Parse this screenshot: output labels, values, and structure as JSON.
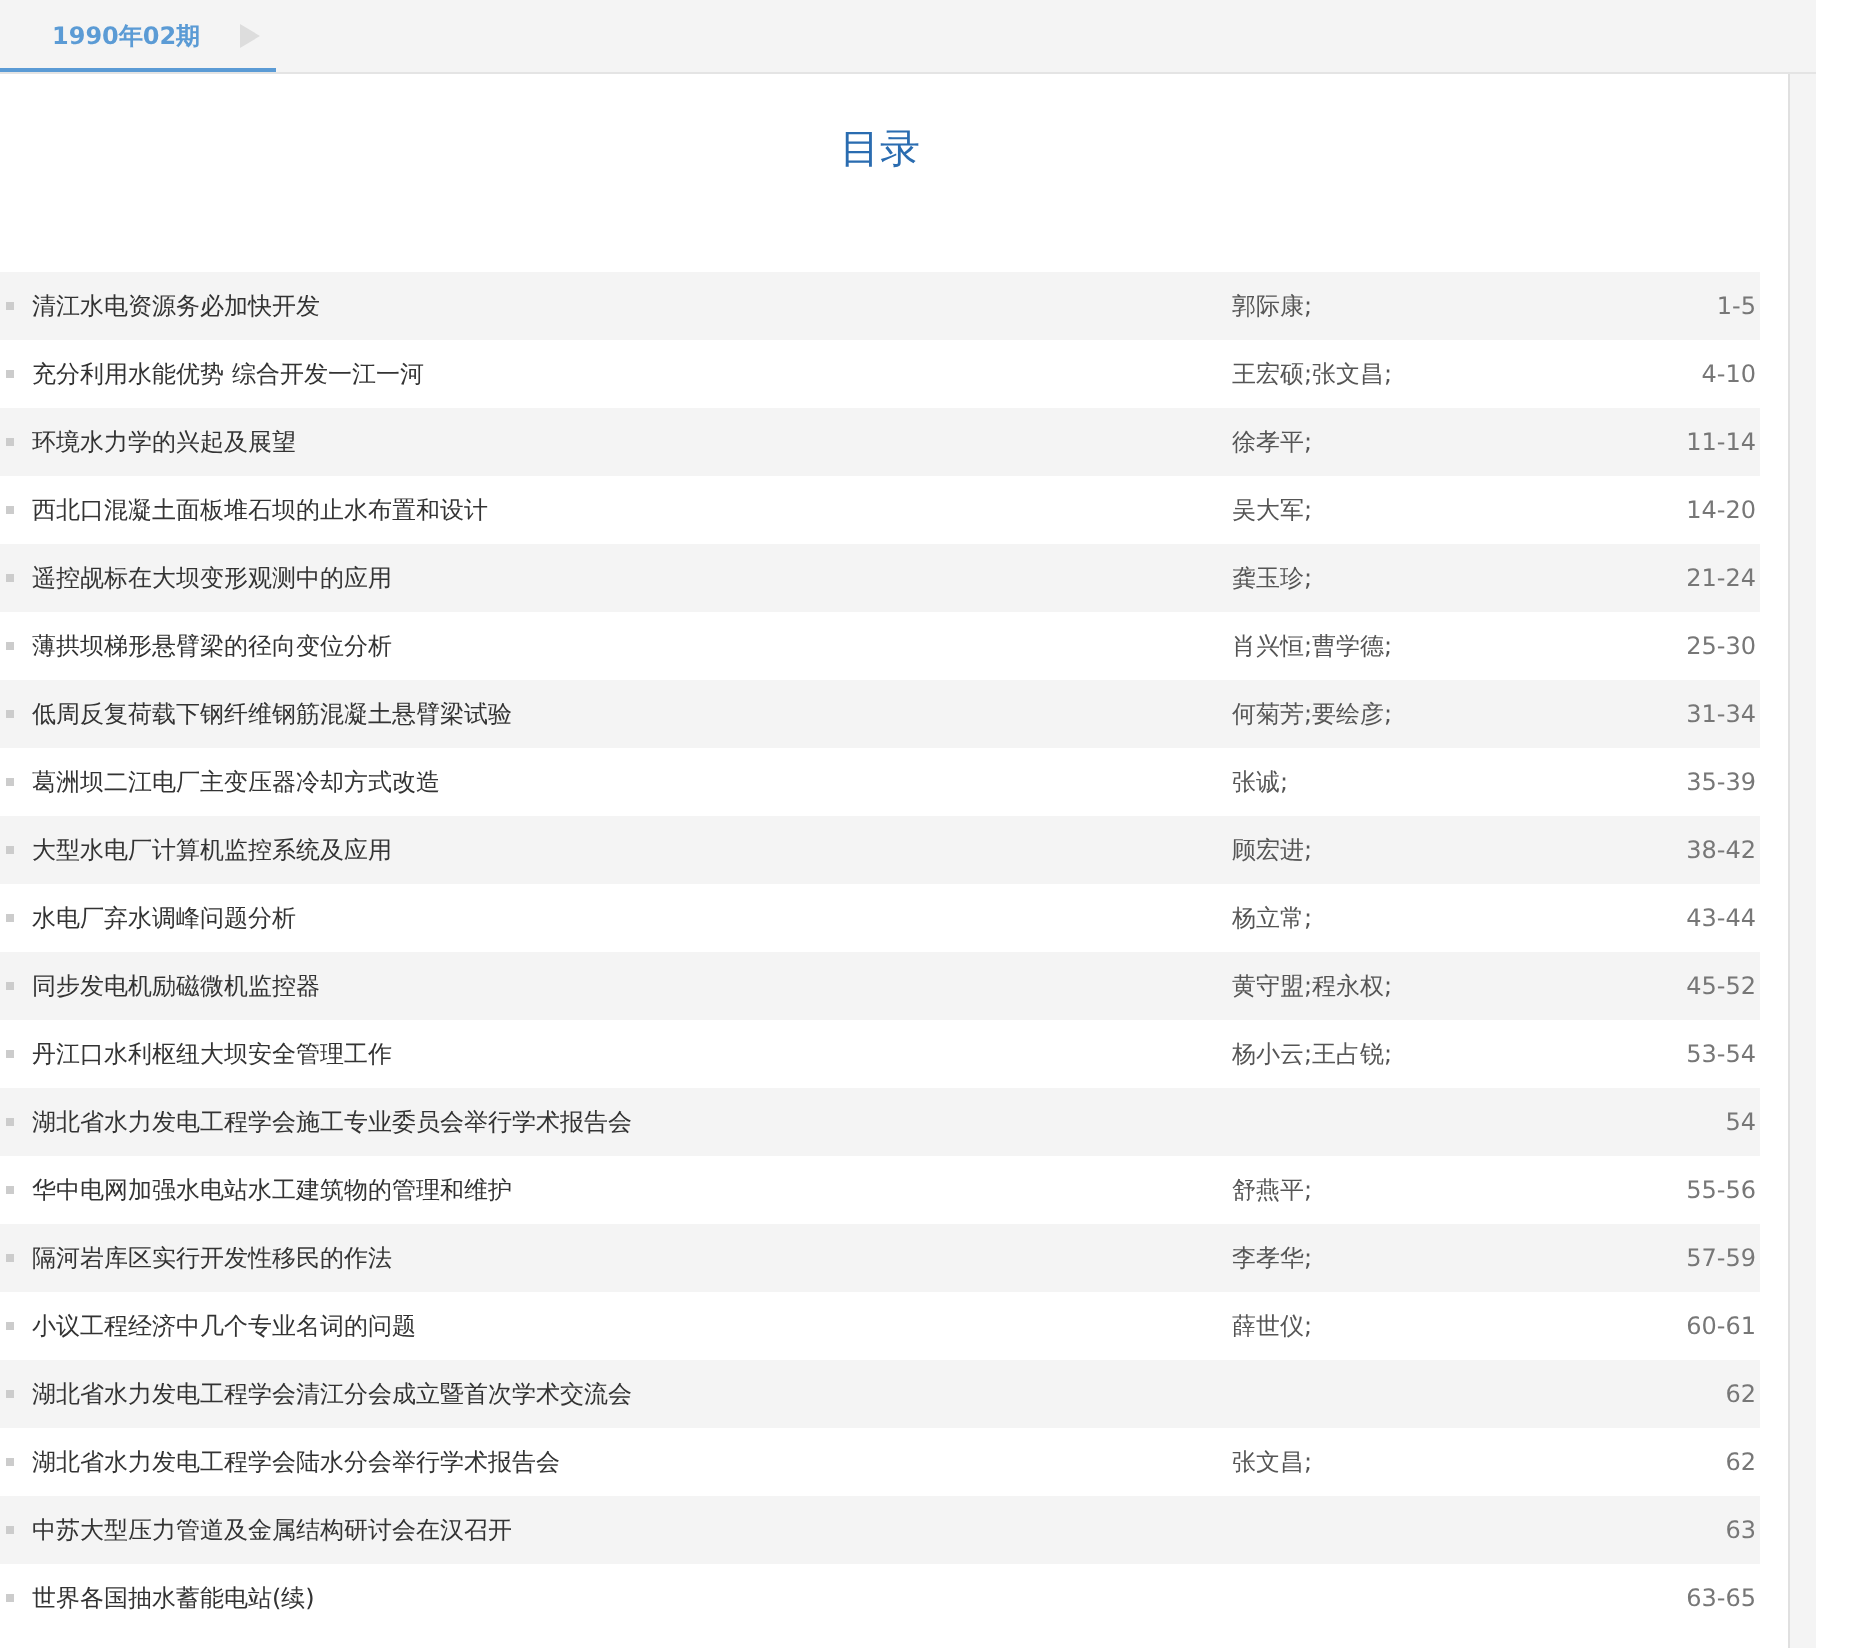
{
  "tabs": [
    {
      "label": "1990年02期",
      "selected": true
    }
  ],
  "title": "目录",
  "articles": [
    {
      "title": "清江水电资源务必加快开发",
      "authors": "郭际康;",
      "pages": "1-5"
    },
    {
      "title": "充分利用水能优势 综合开发一江一河",
      "authors": "王宏硕;张文昌;",
      "pages": "4-10"
    },
    {
      "title": "环境水力学的兴起及展望",
      "authors": "徐孝平;",
      "pages": "11-14"
    },
    {
      "title": "西北口混凝土面板堆石坝的止水布置和设计",
      "authors": "吴大军;",
      "pages": "14-20"
    },
    {
      "title": "遥控觇标在大坝变形观测中的应用",
      "authors": "龚玉珍;",
      "pages": "21-24"
    },
    {
      "title": "薄拱坝梯形悬臂梁的径向变位分析",
      "authors": "肖兴恒;曹学德;",
      "pages": "25-30"
    },
    {
      "title": "低周反复荷载下钢纤维钢筋混凝土悬臂梁试验",
      "authors": "何菊芳;要绘彦;",
      "pages": "31-34"
    },
    {
      "title": "葛洲坝二江电厂主变压器冷却方式改造",
      "authors": "张诚;",
      "pages": "35-39"
    },
    {
      "title": "大型水电厂计算机监控系统及应用",
      "authors": "顾宏进;",
      "pages": "38-42"
    },
    {
      "title": "水电厂弃水调峰问题分析",
      "authors": "杨立常;",
      "pages": "43-44"
    },
    {
      "title": "同步发电机励磁微机监控器",
      "authors": "黄守盟;程永权;",
      "pages": "45-52"
    },
    {
      "title": "丹江口水利枢纽大坝安全管理工作",
      "authors": "杨小云;王占锐;",
      "pages": "53-54"
    },
    {
      "title": "湖北省水力发电工程学会施工专业委员会举行学术报告会",
      "pages": "54"
    },
    {
      "title": "华中电网加强水电站水工建筑物的管理和维护",
      "authors": "舒燕平;",
      "pages": "55-56"
    },
    {
      "title": "隔河岩库区实行开发性移民的作法",
      "authors": "李孝华;",
      "pages": "57-59"
    },
    {
      "title": "小议工程经济中几个专业名词的问题",
      "authors": "薛世仪;",
      "pages": "60-61"
    },
    {
      "title": "湖北省水力发电工程学会清江分会成立暨首次学术交流会",
      "pages": "62"
    },
    {
      "title": "湖北省水力发电工程学会陆水分会举行学术报告会",
      "authors": "张文昌;",
      "pages": "62"
    },
    {
      "title": "中苏大型压力管道及金属结构研讨会在汉召开",
      "pages": "63"
    },
    {
      "title": "世界各国抽水蓄能电站(续)",
      "pages": "63-65"
    }
  ]
}
